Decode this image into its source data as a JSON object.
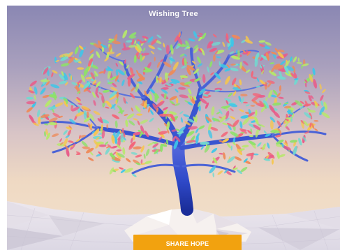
{
  "app": {
    "title": "Wishing Tree"
  },
  "actions": {
    "share_label": "SHARE HOPE"
  },
  "colors": {
    "button": "#f2a20f",
    "trunk": "#2f49c8",
    "sky_top": "#8a87b3",
    "sky_bottom": "#f2e2cd",
    "leaves": [
      "#f2667a",
      "#3fc6e8",
      "#8ee06a",
      "#f5c64d",
      "#ee8a5a",
      "#72d9cf",
      "#e85d8a",
      "#b6e86a"
    ]
  }
}
